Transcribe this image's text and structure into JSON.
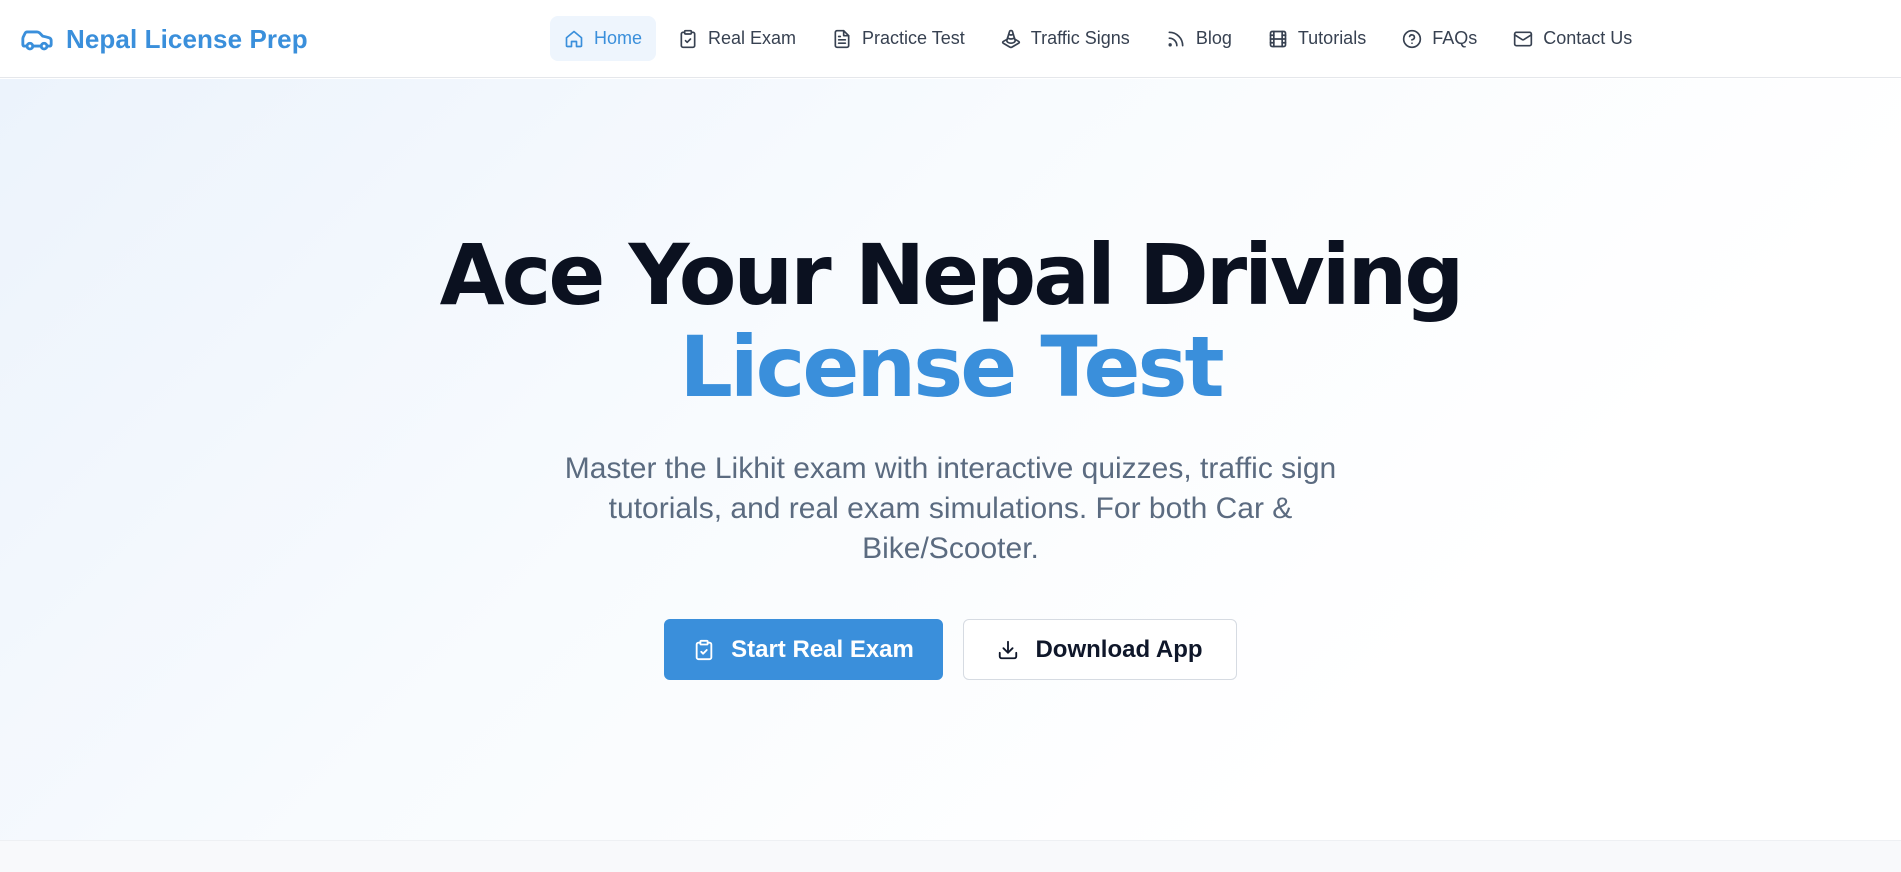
{
  "brand": {
    "name": "Nepal License Prep",
    "icon": "car-icon",
    "color": "#3a8fdb"
  },
  "nav": {
    "items": [
      {
        "label": "Home",
        "icon": "home-icon",
        "active": true
      },
      {
        "label": "Real Exam",
        "icon": "clipboard-check-icon",
        "active": false
      },
      {
        "label": "Practice Test",
        "icon": "document-icon",
        "active": false
      },
      {
        "label": "Traffic Signs",
        "icon": "traffic-cone-icon",
        "active": false
      },
      {
        "label": "Blog",
        "icon": "rss-icon",
        "active": false
      },
      {
        "label": "Tutorials",
        "icon": "film-icon",
        "active": false
      },
      {
        "label": "FAQs",
        "icon": "help-circle-icon",
        "active": false
      },
      {
        "label": "Contact Us",
        "icon": "mail-icon",
        "active": false
      }
    ]
  },
  "hero": {
    "title_line1": "Ace Your Nepal Driving",
    "title_line2": "License Test",
    "subtitle": "Master the Likhit exam with interactive quizzes, traffic sign tutorials, and real exam simulations. For both Car & Bike/Scooter.",
    "primary_button": {
      "label": "Start Real Exam",
      "icon": "clipboard-check-icon"
    },
    "secondary_button": {
      "label": "Download App",
      "icon": "download-icon"
    }
  },
  "colors": {
    "accent": "#3a8fdb",
    "heading": "#0b1120",
    "muted_text": "#5b6b80",
    "active_nav_bg": "#eef5fd"
  }
}
